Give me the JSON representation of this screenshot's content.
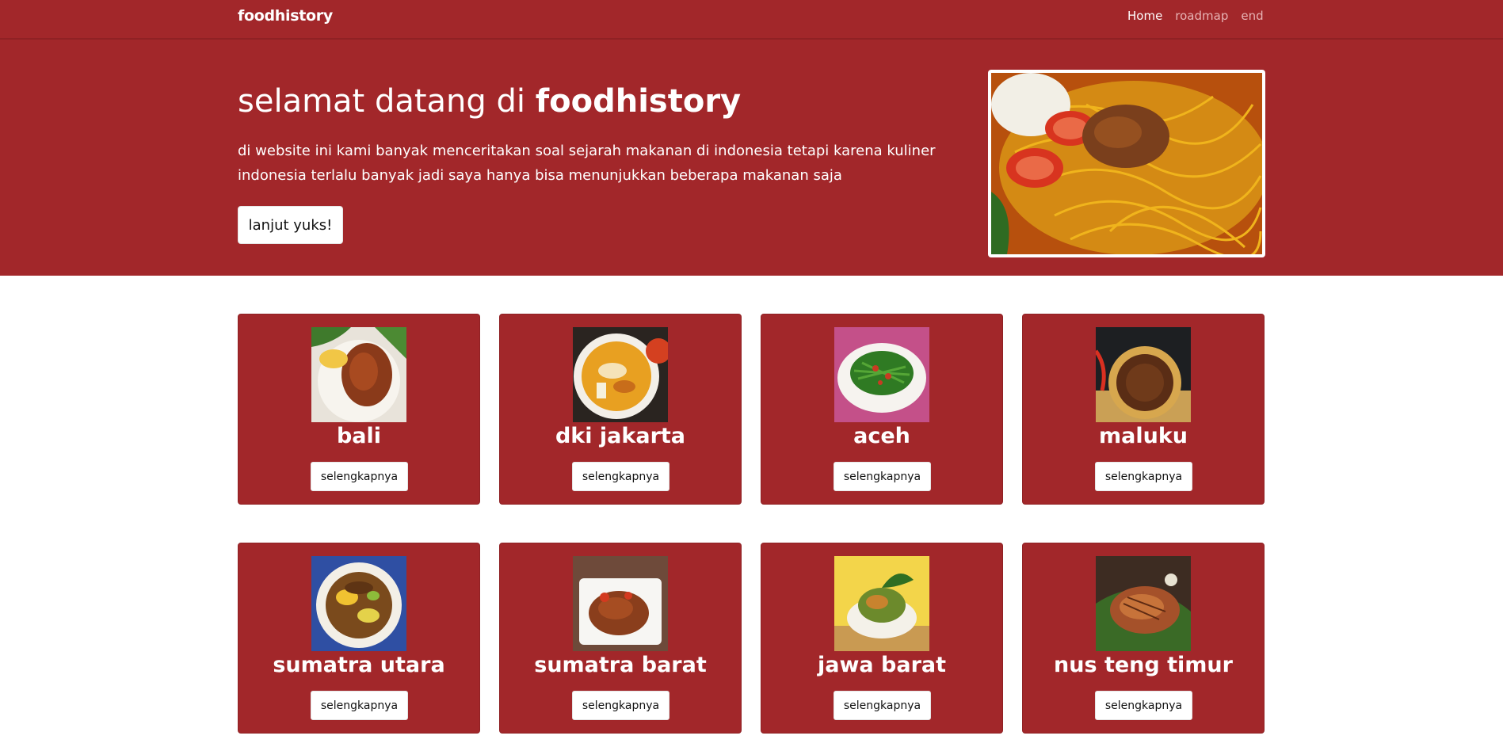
{
  "navbar": {
    "brand": "foodhistory",
    "links": [
      {
        "label": "Home",
        "active": true
      },
      {
        "label": "roadmap",
        "active": false
      },
      {
        "label": "end",
        "active": false
      }
    ]
  },
  "hero": {
    "title_prefix": "selamat datang di ",
    "title_brand": "foodhistory",
    "text": "di website ini kami banyak menceritakan soal sejarah makanan di indonesia tetapi karena kuliner indonesia terlalu banyak jadi saya hanya bisa menunjukkan beberapa makanan saja",
    "button_label": "lanjut yuks!",
    "image": "noodle-dish-photo"
  },
  "cards": [
    {
      "title": "bali",
      "button_label": "selengkapnya",
      "image": "grilled-chicken-photo"
    },
    {
      "title": "dki jakarta",
      "button_label": "selengkapnya",
      "image": "soup-bowl-photo"
    },
    {
      "title": "aceh",
      "button_label": "selengkapnya",
      "image": "green-vegetable-photo"
    },
    {
      "title": "maluku",
      "button_label": "selengkapnya",
      "image": "fried-fish-plate-photo"
    },
    {
      "title": "sumatra utara",
      "button_label": "selengkapnya",
      "image": "rujak-plate-photo"
    },
    {
      "title": "sumatra barat",
      "button_label": "selengkapnya",
      "image": "rendang-plate-photo"
    },
    {
      "title": "jawa barat",
      "button_label": "selengkapnya",
      "image": "karedok-bowl-photo"
    },
    {
      "title": "nus teng timur",
      "button_label": "selengkapnya",
      "image": "grilled-fish-photo"
    }
  ],
  "colors": {
    "primary": "#a2272a",
    "border": "#8f2124",
    "background": "#ffffff"
  }
}
